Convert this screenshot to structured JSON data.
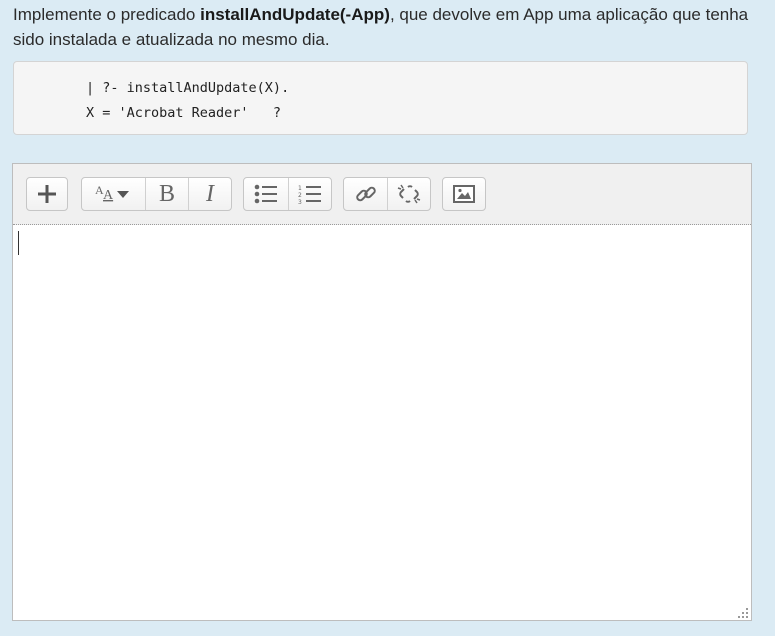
{
  "question": {
    "prefix": "Implemente o predicado ",
    "predicate": "installAndUpdate(-App)",
    "suffix": ", que devolve em App uma aplicação que tenha sido instalada e atualizada no mesmo dia."
  },
  "code_example": {
    "line1": "| ?- installAndUpdate(X).",
    "line2": "X = 'Acrobat Reader'   ?"
  },
  "toolbar": {
    "icons": [
      "plus-icon",
      "font-size-icon",
      "bold-icon",
      "italic-icon",
      "bullet-list-icon",
      "numbered-list-icon",
      "link-icon",
      "unlink-icon",
      "image-icon"
    ],
    "bold_label": "B",
    "italic_label": "I"
  },
  "editor": {
    "value": ""
  }
}
